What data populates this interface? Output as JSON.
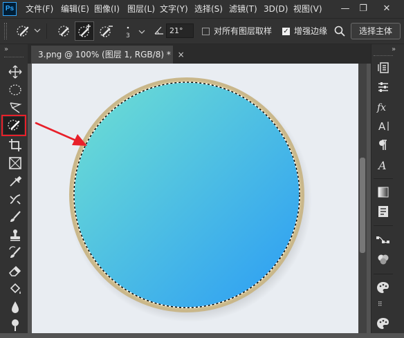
{
  "app": {
    "logo": "Ps"
  },
  "menu": [
    "文件(F)",
    "编辑(E)",
    "图像(I)",
    "图层(L)",
    "文字(Y)",
    "选择(S)",
    "滤镜(T)",
    "3D(D)",
    "视图(V)"
  ],
  "window_controls": {
    "minimize": "—",
    "restore": "❐",
    "close": "✕"
  },
  "options": {
    "brush_size": "3",
    "angle_value": "21°",
    "sample_all_layers_label": "对所有图层取样",
    "sample_all_layers_checked": false,
    "enhance_edge_label": "增强边缘",
    "enhance_edge_checked": true,
    "select_subject_label": "选择主体"
  },
  "collapse_glyph": "»",
  "document_tab": {
    "title": "3.png @ 100% (图层 1, RGB/8) *",
    "close": "×"
  },
  "canvas": {
    "frame_color": "#c9b78a",
    "gradient_start": "#6fe0d2",
    "gradient_end": "#2b9cf5",
    "annotation_color": "#e8202a"
  },
  "tools": [
    "move-tool",
    "elliptical-marquee-tool",
    "lasso-tool",
    "quick-selection-tool",
    "crop-tool",
    "frame-tool",
    "eyedropper-tool",
    "healing-brush-tool",
    "brush-tool",
    "clone-stamp-tool",
    "history-brush-tool",
    "eraser-tool",
    "paint-bucket-tool",
    "blur-tool",
    "dodge-tool"
  ]
}
